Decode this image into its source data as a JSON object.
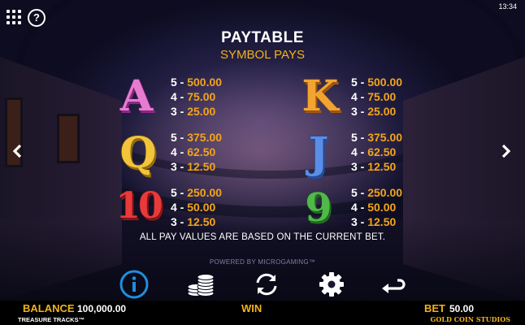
{
  "status": {
    "time": "13:34"
  },
  "header": {
    "title": "PAYTABLE",
    "subtitle": "SYMBOL PAYS"
  },
  "symbols": [
    {
      "glyph": "A",
      "color": "#e77bd0",
      "pays": [
        {
          "count": "5 - ",
          "amount": "500.00"
        },
        {
          "count": "4 - ",
          "amount": "75.00"
        },
        {
          "count": "3 - ",
          "amount": "25.00"
        }
      ]
    },
    {
      "glyph": "K",
      "color": "#f2a431",
      "pays": [
        {
          "count": "5 - ",
          "amount": "500.00"
        },
        {
          "count": "4 - ",
          "amount": "75.00"
        },
        {
          "count": "3 - ",
          "amount": "25.00"
        }
      ]
    },
    {
      "glyph": "Q",
      "color": "#f1c43a",
      "pays": [
        {
          "count": "5 - ",
          "amount": "375.00"
        },
        {
          "count": "4 - ",
          "amount": "62.50"
        },
        {
          "count": "3 - ",
          "amount": "12.50"
        }
      ]
    },
    {
      "glyph": "J",
      "color": "#5a8ee6",
      "pays": [
        {
          "count": "5 - ",
          "amount": "375.00"
        },
        {
          "count": "4 - ",
          "amount": "62.50"
        },
        {
          "count": "3 - ",
          "amount": "12.50"
        }
      ]
    },
    {
      "glyph": "10",
      "color": "#e83a3a",
      "pays": [
        {
          "count": "5 - ",
          "amount": "250.00"
        },
        {
          "count": "4 - ",
          "amount": "50.00"
        },
        {
          "count": "3 - ",
          "amount": "12.50"
        }
      ]
    },
    {
      "glyph": "9",
      "color": "#4fb94a",
      "pays": [
        {
          "count": "5 - ",
          "amount": "250.00"
        },
        {
          "count": "4 - ",
          "amount": "50.00"
        },
        {
          "count": "3 - ",
          "amount": "12.50"
        }
      ]
    }
  ],
  "note": "ALL PAY VALUES ARE BASED ON THE CURRENT BET.",
  "powered_by": "POWERED BY MICROGAMING™",
  "toolbar": {
    "icons": [
      "info-icon",
      "coins-icon",
      "autoplay-icon",
      "settings-icon",
      "back-icon"
    ],
    "accent": "#1e8fe0"
  },
  "bottom_bar": {
    "balance_label": "BALANCE",
    "balance_value": "100,000.00",
    "win_label": "WIN",
    "bet_label": "BET",
    "bet_value": "50.00",
    "game_name": "TREASURE TRACKS™",
    "studio": "GOLD COIN STUDIOS"
  },
  "colors": {
    "gold": "#f3b21b",
    "amount": "#f3a41b"
  }
}
